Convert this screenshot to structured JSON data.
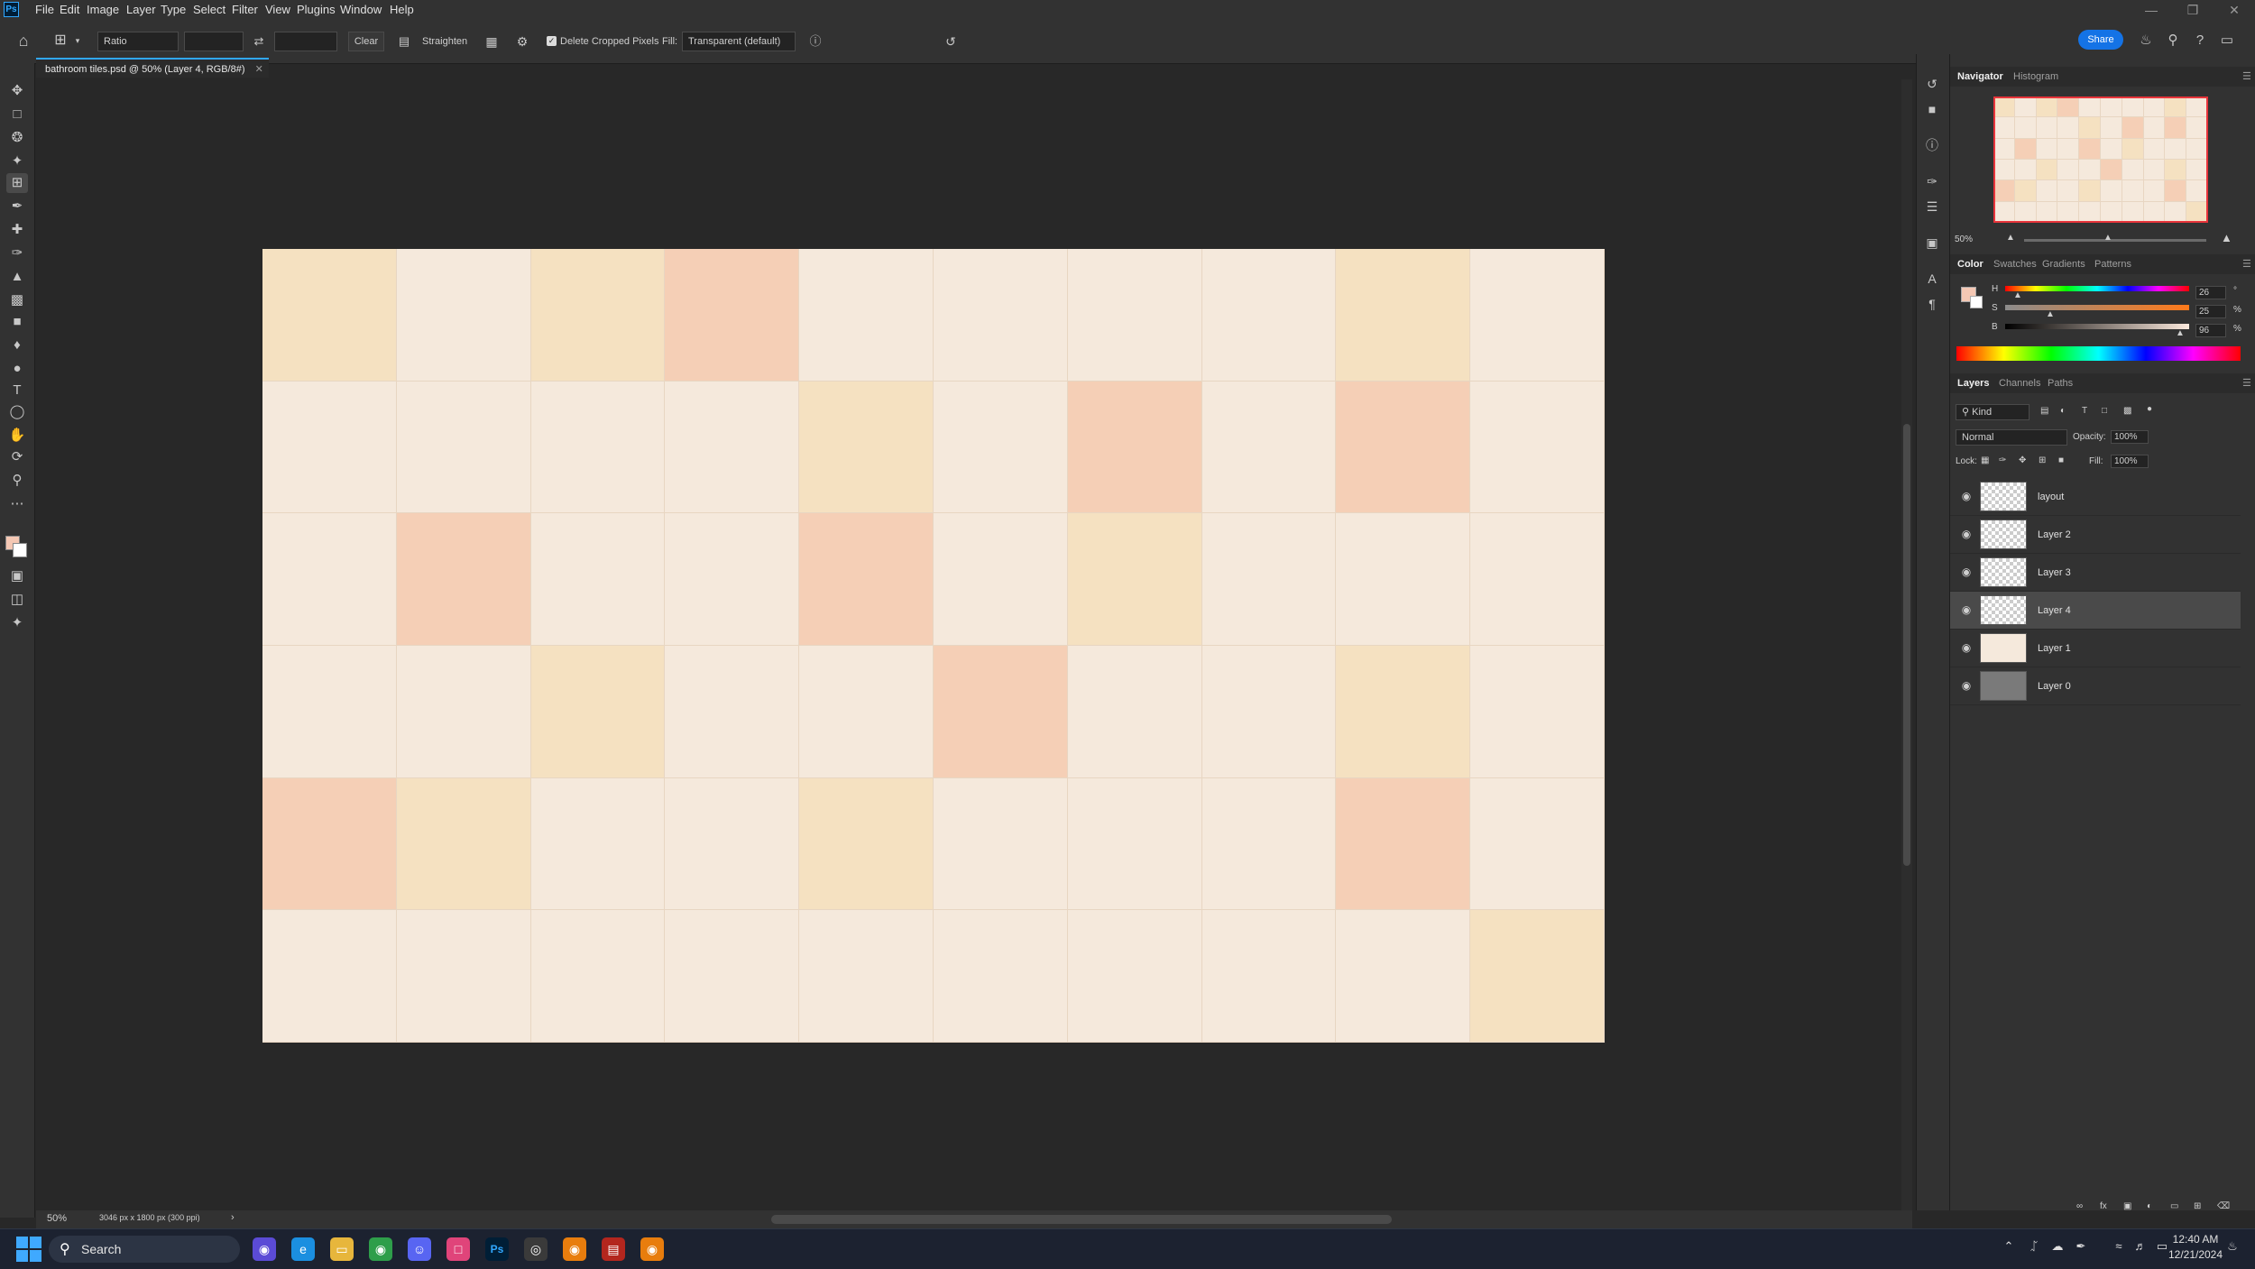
{
  "app": {
    "logo": "Ps",
    "menu": [
      "File",
      "Edit",
      "Image",
      "Layer",
      "Type",
      "Select",
      "Filter",
      "View",
      "Plugins",
      "Window",
      "Help"
    ]
  },
  "options": {
    "ratio_value": "Ratio",
    "clear_label": "Clear",
    "straighten_label": "Straighten",
    "delete_cropped_label": "Delete Cropped Pixels",
    "fill_label": "Fill:",
    "fill_value": "Transparent (default)",
    "share_label": "Share"
  },
  "document": {
    "tab_title": "bathroom tiles.psd @ 50% (Layer 4, RGB/8#)",
    "zoom": "50%",
    "doc_size": "3046 px x 1800 px (300 ppi)"
  },
  "colors": {
    "cream": "#f5e9dc",
    "yellow": "#f5e1c1",
    "pink": "#f5cfb6",
    "foreground": "#f5c8b4",
    "accent": "#31a8ff"
  },
  "tiles": [
    [
      "yellow",
      "cream",
      "yellow",
      "pink",
      "cream",
      "cream",
      "cream",
      "cream",
      "yellow",
      "cream"
    ],
    [
      "cream",
      "cream",
      "cream",
      "cream",
      "yellow",
      "cream",
      "pink",
      "cream",
      "pink",
      "cream"
    ],
    [
      "cream",
      "pink",
      "cream",
      "cream",
      "pink",
      "cream",
      "yellow",
      "cream",
      "cream",
      "cream"
    ],
    [
      "cream",
      "cream",
      "yellow",
      "cream",
      "cream",
      "pink",
      "cream",
      "cream",
      "yellow",
      "cream"
    ],
    [
      "pink",
      "yellow",
      "cream",
      "cream",
      "yellow",
      "cream",
      "cream",
      "cream",
      "pink",
      "cream"
    ],
    [
      "cream",
      "cream",
      "cream",
      "cream",
      "cream",
      "cream",
      "cream",
      "cream",
      "cream",
      "yellow"
    ]
  ],
  "navigator": {
    "tabs": [
      "Navigator",
      "Histogram"
    ],
    "zoom": "50%"
  },
  "color_panel": {
    "tabs": [
      "Color",
      "Swatches",
      "Gradients",
      "Patterns"
    ],
    "h_label": "H",
    "h_value": "26",
    "h_unit": "°",
    "s_label": "S",
    "s_value": "25",
    "s_unit": "%",
    "b_label": "B",
    "b_value": "96",
    "b_unit": "%"
  },
  "layers_panel": {
    "tabs": [
      "Layers",
      "Channels",
      "Paths"
    ],
    "filter": "Kind",
    "blend_mode": "Normal",
    "opacity_label": "Opacity:",
    "opacity_value": "100%",
    "lock_label": "Lock:",
    "fill_label": "Fill:",
    "fill_value": "100%",
    "layers": [
      {
        "name": "layout",
        "thumb": "checker"
      },
      {
        "name": "Layer 2",
        "thumb": "checker"
      },
      {
        "name": "Layer 3",
        "thumb": "checker"
      },
      {
        "name": "Layer 4",
        "thumb": "checker",
        "selected": true
      },
      {
        "name": "Layer 1",
        "thumb": "#f5e9dc"
      },
      {
        "name": "Layer 0",
        "thumb": "#7a7a7a"
      }
    ]
  },
  "taskbar": {
    "search_placeholder": "Search",
    "time": "12:40 AM",
    "date": "12/21/2024"
  }
}
